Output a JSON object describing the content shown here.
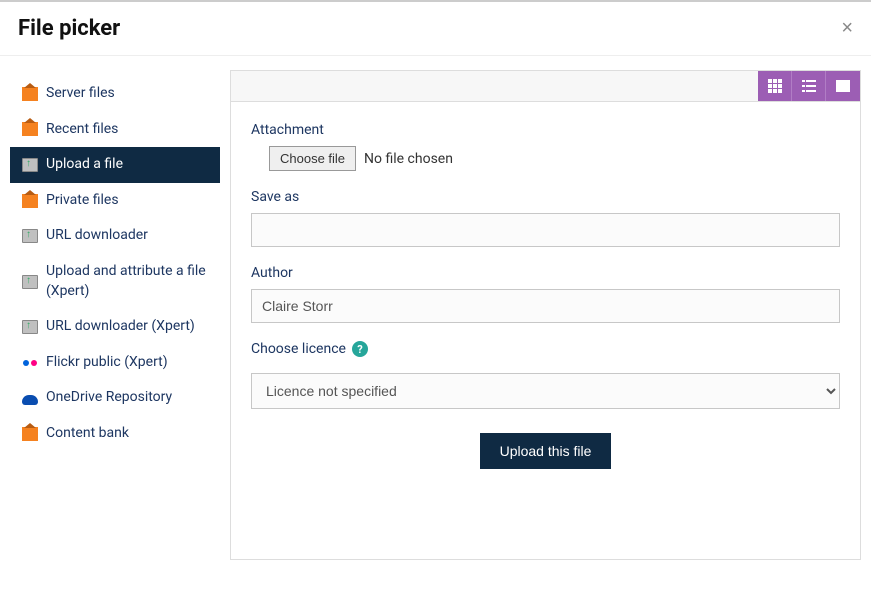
{
  "header": {
    "title": "File picker"
  },
  "sidebar": {
    "items": [
      {
        "label": "Server files",
        "icon": "home"
      },
      {
        "label": "Recent files",
        "icon": "home"
      },
      {
        "label": "Upload a file",
        "icon": "upload",
        "active": true
      },
      {
        "label": "Private files",
        "icon": "home"
      },
      {
        "label": "URL downloader",
        "icon": "upload"
      },
      {
        "label": "Upload and attribute a file (Xpert)",
        "icon": "upload"
      },
      {
        "label": "URL downloader (Xpert)",
        "icon": "upload"
      },
      {
        "label": "Flickr public (Xpert)",
        "icon": "flickr"
      },
      {
        "label": "OneDrive Repository",
        "icon": "onedrive"
      },
      {
        "label": "Content bank",
        "icon": "home"
      }
    ]
  },
  "form": {
    "attachment_label": "Attachment",
    "choose_file_label": "Choose file",
    "no_file_text": "No file chosen",
    "saveas_label": "Save as",
    "saveas_value": "",
    "author_label": "Author",
    "author_value": "Claire Storr",
    "licence_label": "Choose licence",
    "licence_value": "Licence not specified",
    "submit_label": "Upload this file"
  }
}
